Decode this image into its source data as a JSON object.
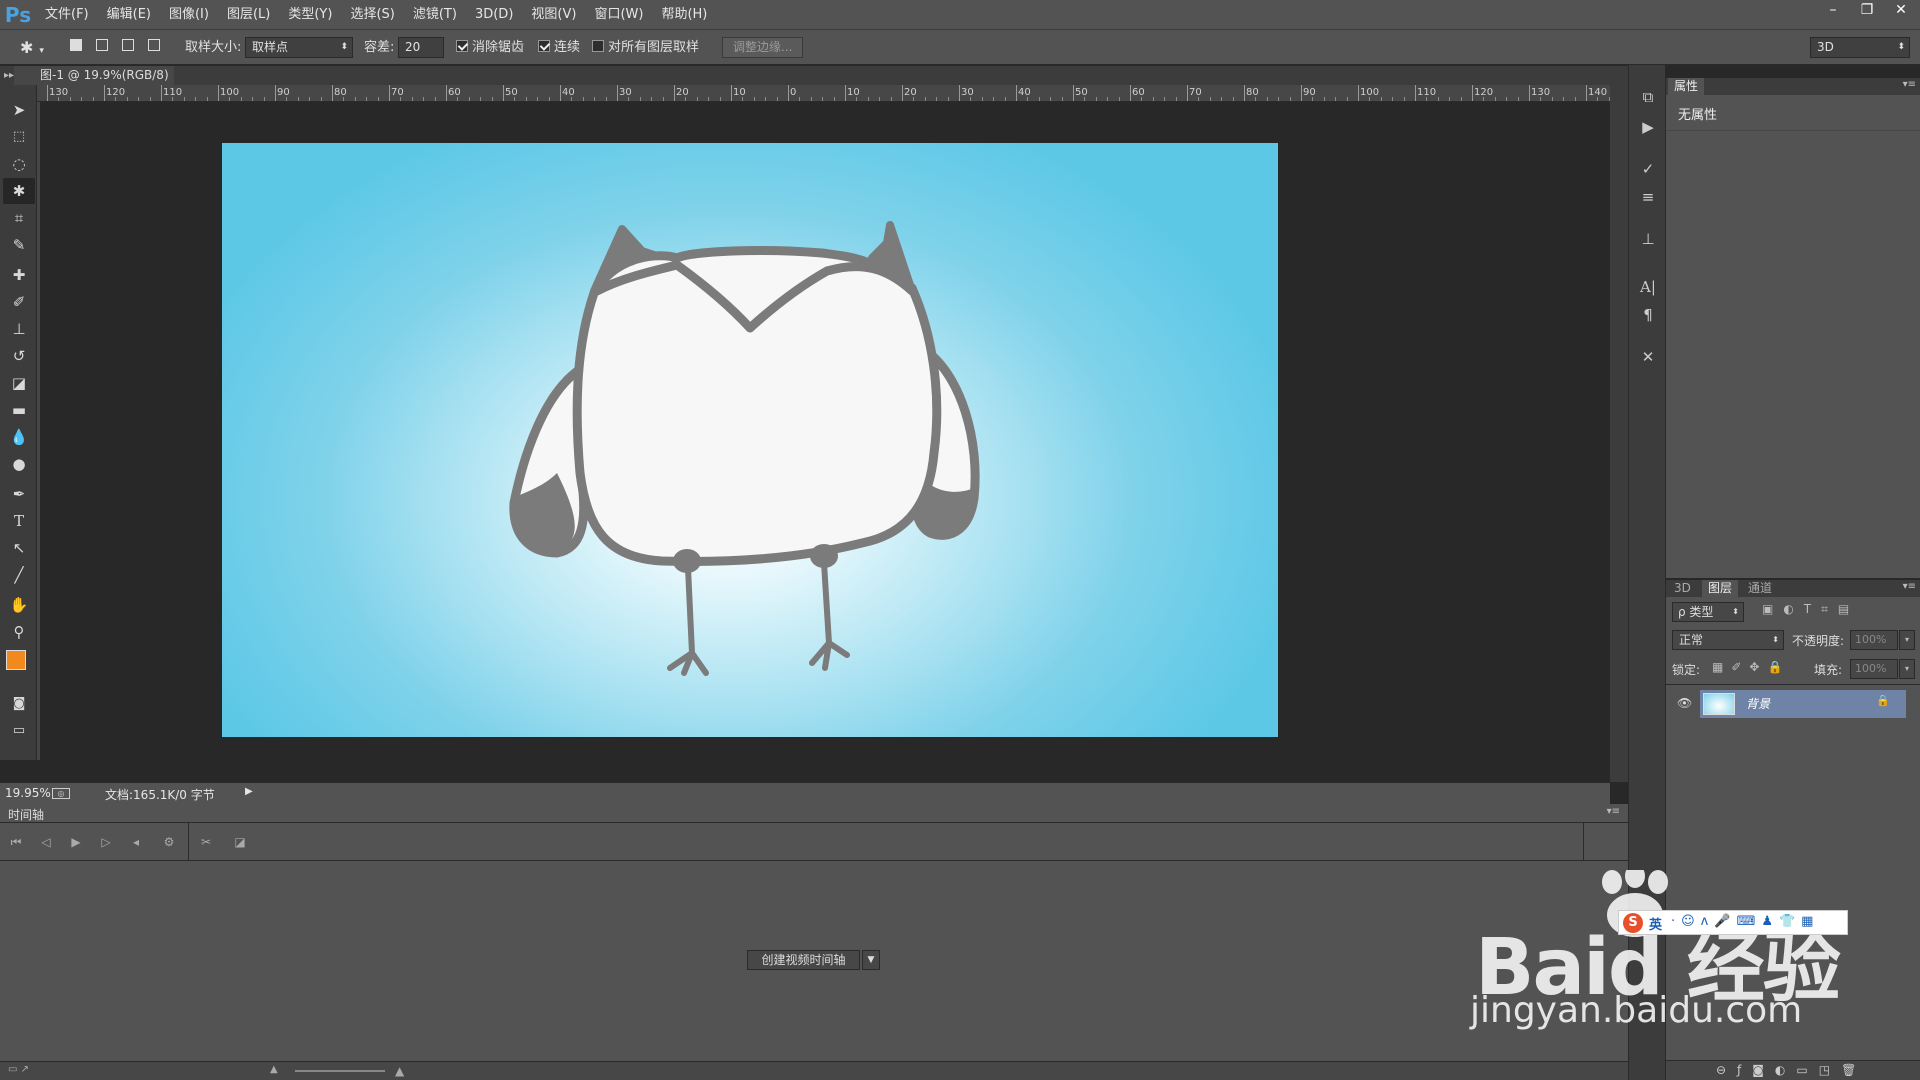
{
  "app": {
    "logo": "Ps"
  },
  "menu": [
    "文件(F)",
    "编辑(E)",
    "图像(I)",
    "图层(L)",
    "类型(Y)",
    "选择(S)",
    "滤镜(T)",
    "3D(D)",
    "视图(V)",
    "窗口(W)",
    "帮助(H)"
  ],
  "window_controls": [
    "–",
    "❐",
    "✕"
  ],
  "options": {
    "sample_size_label": "取样大小:",
    "sample_size_value": "取样点",
    "tolerance_label": "容差:",
    "tolerance_value": "20",
    "anti_alias_label": "消除锯齿",
    "anti_alias_checked": true,
    "contiguous_label": "连续",
    "contiguous_checked": true,
    "sample_all_label": "对所有图层取样",
    "sample_all_checked": false,
    "refine_edge_label": "调整边缘...",
    "workspace_value": "3D"
  },
  "document": {
    "tab_title": "图-1 @ 19.9%(RGB/8)",
    "close": "×",
    "background_start": "#ffffff",
    "background_end": "#5cc8e6"
  },
  "ruler_ticks": [
    "130",
    "120",
    "110",
    "100",
    "90",
    "80",
    "70",
    "60",
    "50",
    "40",
    "30",
    "20",
    "10",
    "0",
    "10",
    "20",
    "30",
    "40",
    "50",
    "60",
    "70",
    "80",
    "90",
    "100",
    "110",
    "120",
    "130",
    "140"
  ],
  "status": {
    "zoom": "19.95%",
    "doc_info": "文档:165.1K/0 字节"
  },
  "timeline": {
    "title": "时间轴",
    "create_button": "创建视频时间轴"
  },
  "properties_panel": {
    "tab": "属性",
    "content": "无属性"
  },
  "layers_panel": {
    "tabs": [
      "3D",
      "图层",
      "通道"
    ],
    "active_tab": "图层",
    "filter_label": "ρ 类型",
    "blend_mode": "正常",
    "opacity_label": "不透明度:",
    "opacity_value": "100%",
    "lock_label": "锁定:",
    "fill_label": "填充:",
    "fill_value": "100%",
    "layers": [
      {
        "name": "背景",
        "visible": true,
        "locked": true
      }
    ]
  },
  "watermark": {
    "text": "Baid 经验",
    "url": "jingyan.baidu.com",
    "ime_label": "英"
  },
  "colors": {
    "foreground": "#f08a1e",
    "background": "#4a9fe0",
    "selected_layer": "#6e83a6"
  }
}
